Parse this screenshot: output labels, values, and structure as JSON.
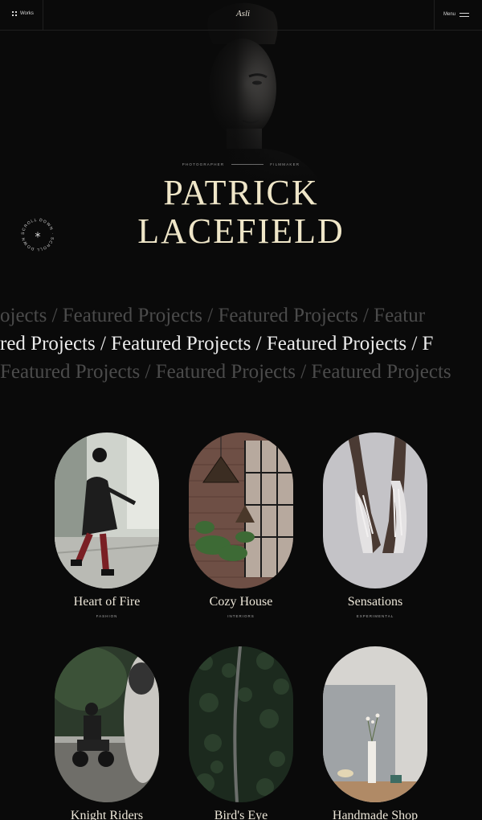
{
  "header": {
    "works_label": "Works",
    "logo_text": "Asli",
    "menu_label": "Menu",
    "works_icon": "grid-icon",
    "menu_icon": "hamburger-icon"
  },
  "hero": {
    "role_left": "PHOTOGRAPHER",
    "role_right": "FILMMAKER",
    "name_line1": "PATRICK",
    "name_line2": "LACEFIELD",
    "scroll_badge_text": "SCROLL DOWN · SCROLL DOWN ·",
    "badge_icon": "asterisk-icon"
  },
  "marquee": {
    "row1": "ojects  /  Featured Projects  /  Featured Projects  /  Featur",
    "row2": "red Projects  /  Featured Projects  /  Featured Projects  /  F",
    "row3": "Featured Projects  /  Featured Projects  /  Featured Projects"
  },
  "projects": [
    {
      "title": "Heart of Fire",
      "category": "FASHION"
    },
    {
      "title": "Cozy House",
      "category": "INTERIORS"
    },
    {
      "title": "Sensations",
      "category": "EXPERIMENTAL"
    },
    {
      "title": "Knight Riders",
      "category": ""
    },
    {
      "title": "Bird's Eye",
      "category": ""
    },
    {
      "title": "Handmade Shop",
      "category": ""
    }
  ],
  "colors": {
    "background": "#0a0a0a",
    "headline": "#efe6c8",
    "marquee_dim": "#4b4b4b",
    "marquee_bright": "#ececec"
  }
}
